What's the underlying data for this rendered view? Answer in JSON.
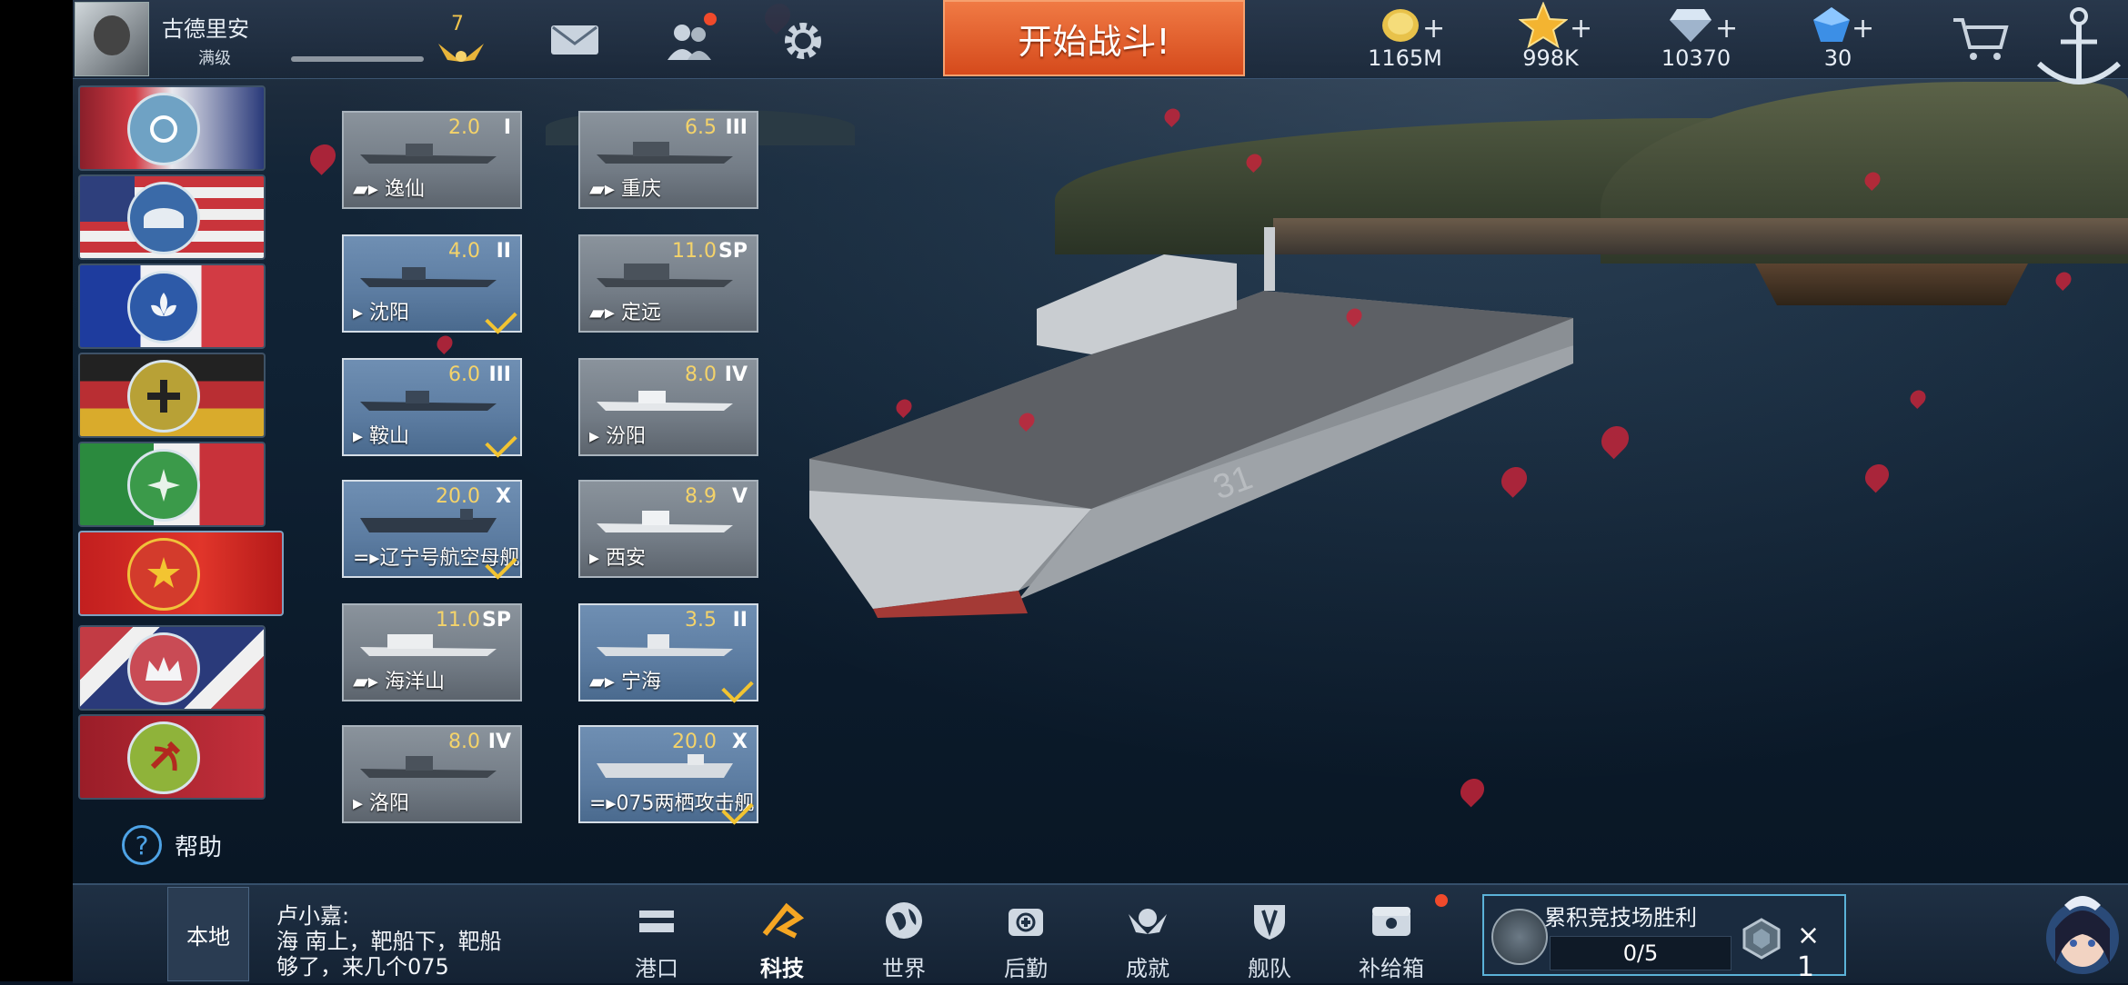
{
  "player": {
    "name": "古德里安",
    "level_text": "满级",
    "rank": "7"
  },
  "top_actions": {
    "start_battle": "开始战斗!"
  },
  "currencies": [
    {
      "name": "gold-coin",
      "value": "1165M"
    },
    {
      "name": "star",
      "value": "998K"
    },
    {
      "name": "diamond",
      "value": "10370"
    },
    {
      "name": "blue-crystal",
      "value": "30"
    }
  ],
  "nations": [
    "uk",
    "usa",
    "france",
    "germany",
    "italy",
    "china",
    "navy-jack",
    "soviet"
  ],
  "help_label": "帮助",
  "ships": [
    {
      "name": "逸仙",
      "level": "2.0",
      "tier": "I"
    },
    {
      "name": "重庆",
      "level": "6.5",
      "tier": "III"
    },
    {
      "name": "沈阳",
      "level": "4.0",
      "tier": "II"
    },
    {
      "name": "定远",
      "level": "11.0",
      "tier": "SP"
    },
    {
      "name": "鞍山",
      "level": "6.0",
      "tier": "III"
    },
    {
      "name": "汾阳",
      "level": "8.0",
      "tier": "IV"
    },
    {
      "name": "辽宁号航空母舰",
      "level": "20.0",
      "tier": "X"
    },
    {
      "name": "西安",
      "level": "8.9",
      "tier": "V"
    },
    {
      "name": "海洋山",
      "level": "11.0",
      "tier": "SP"
    },
    {
      "name": "宁海",
      "level": "3.5",
      "tier": "II"
    },
    {
      "name": "洛阳",
      "level": "8.0",
      "tier": "IV"
    },
    {
      "name": "075两栖攻击舰",
      "level": "20.0",
      "tier": "X"
    }
  ],
  "chat": {
    "channel": "本地",
    "sender": "卢小嘉:",
    "message": "海 南上，靶船下，靶船够了，来几个075"
  },
  "nav": [
    "港口",
    "科技",
    "世界",
    "后勤",
    "成就",
    "舰队",
    "补给箱"
  ],
  "quest": {
    "title": "累积竞技场胜利",
    "progress": "0/5",
    "reward_count": "× 1"
  },
  "colors": {
    "start_button": "#e0592a",
    "accent_gold": "#f2c431",
    "quest_border": "#5bb2d8"
  }
}
